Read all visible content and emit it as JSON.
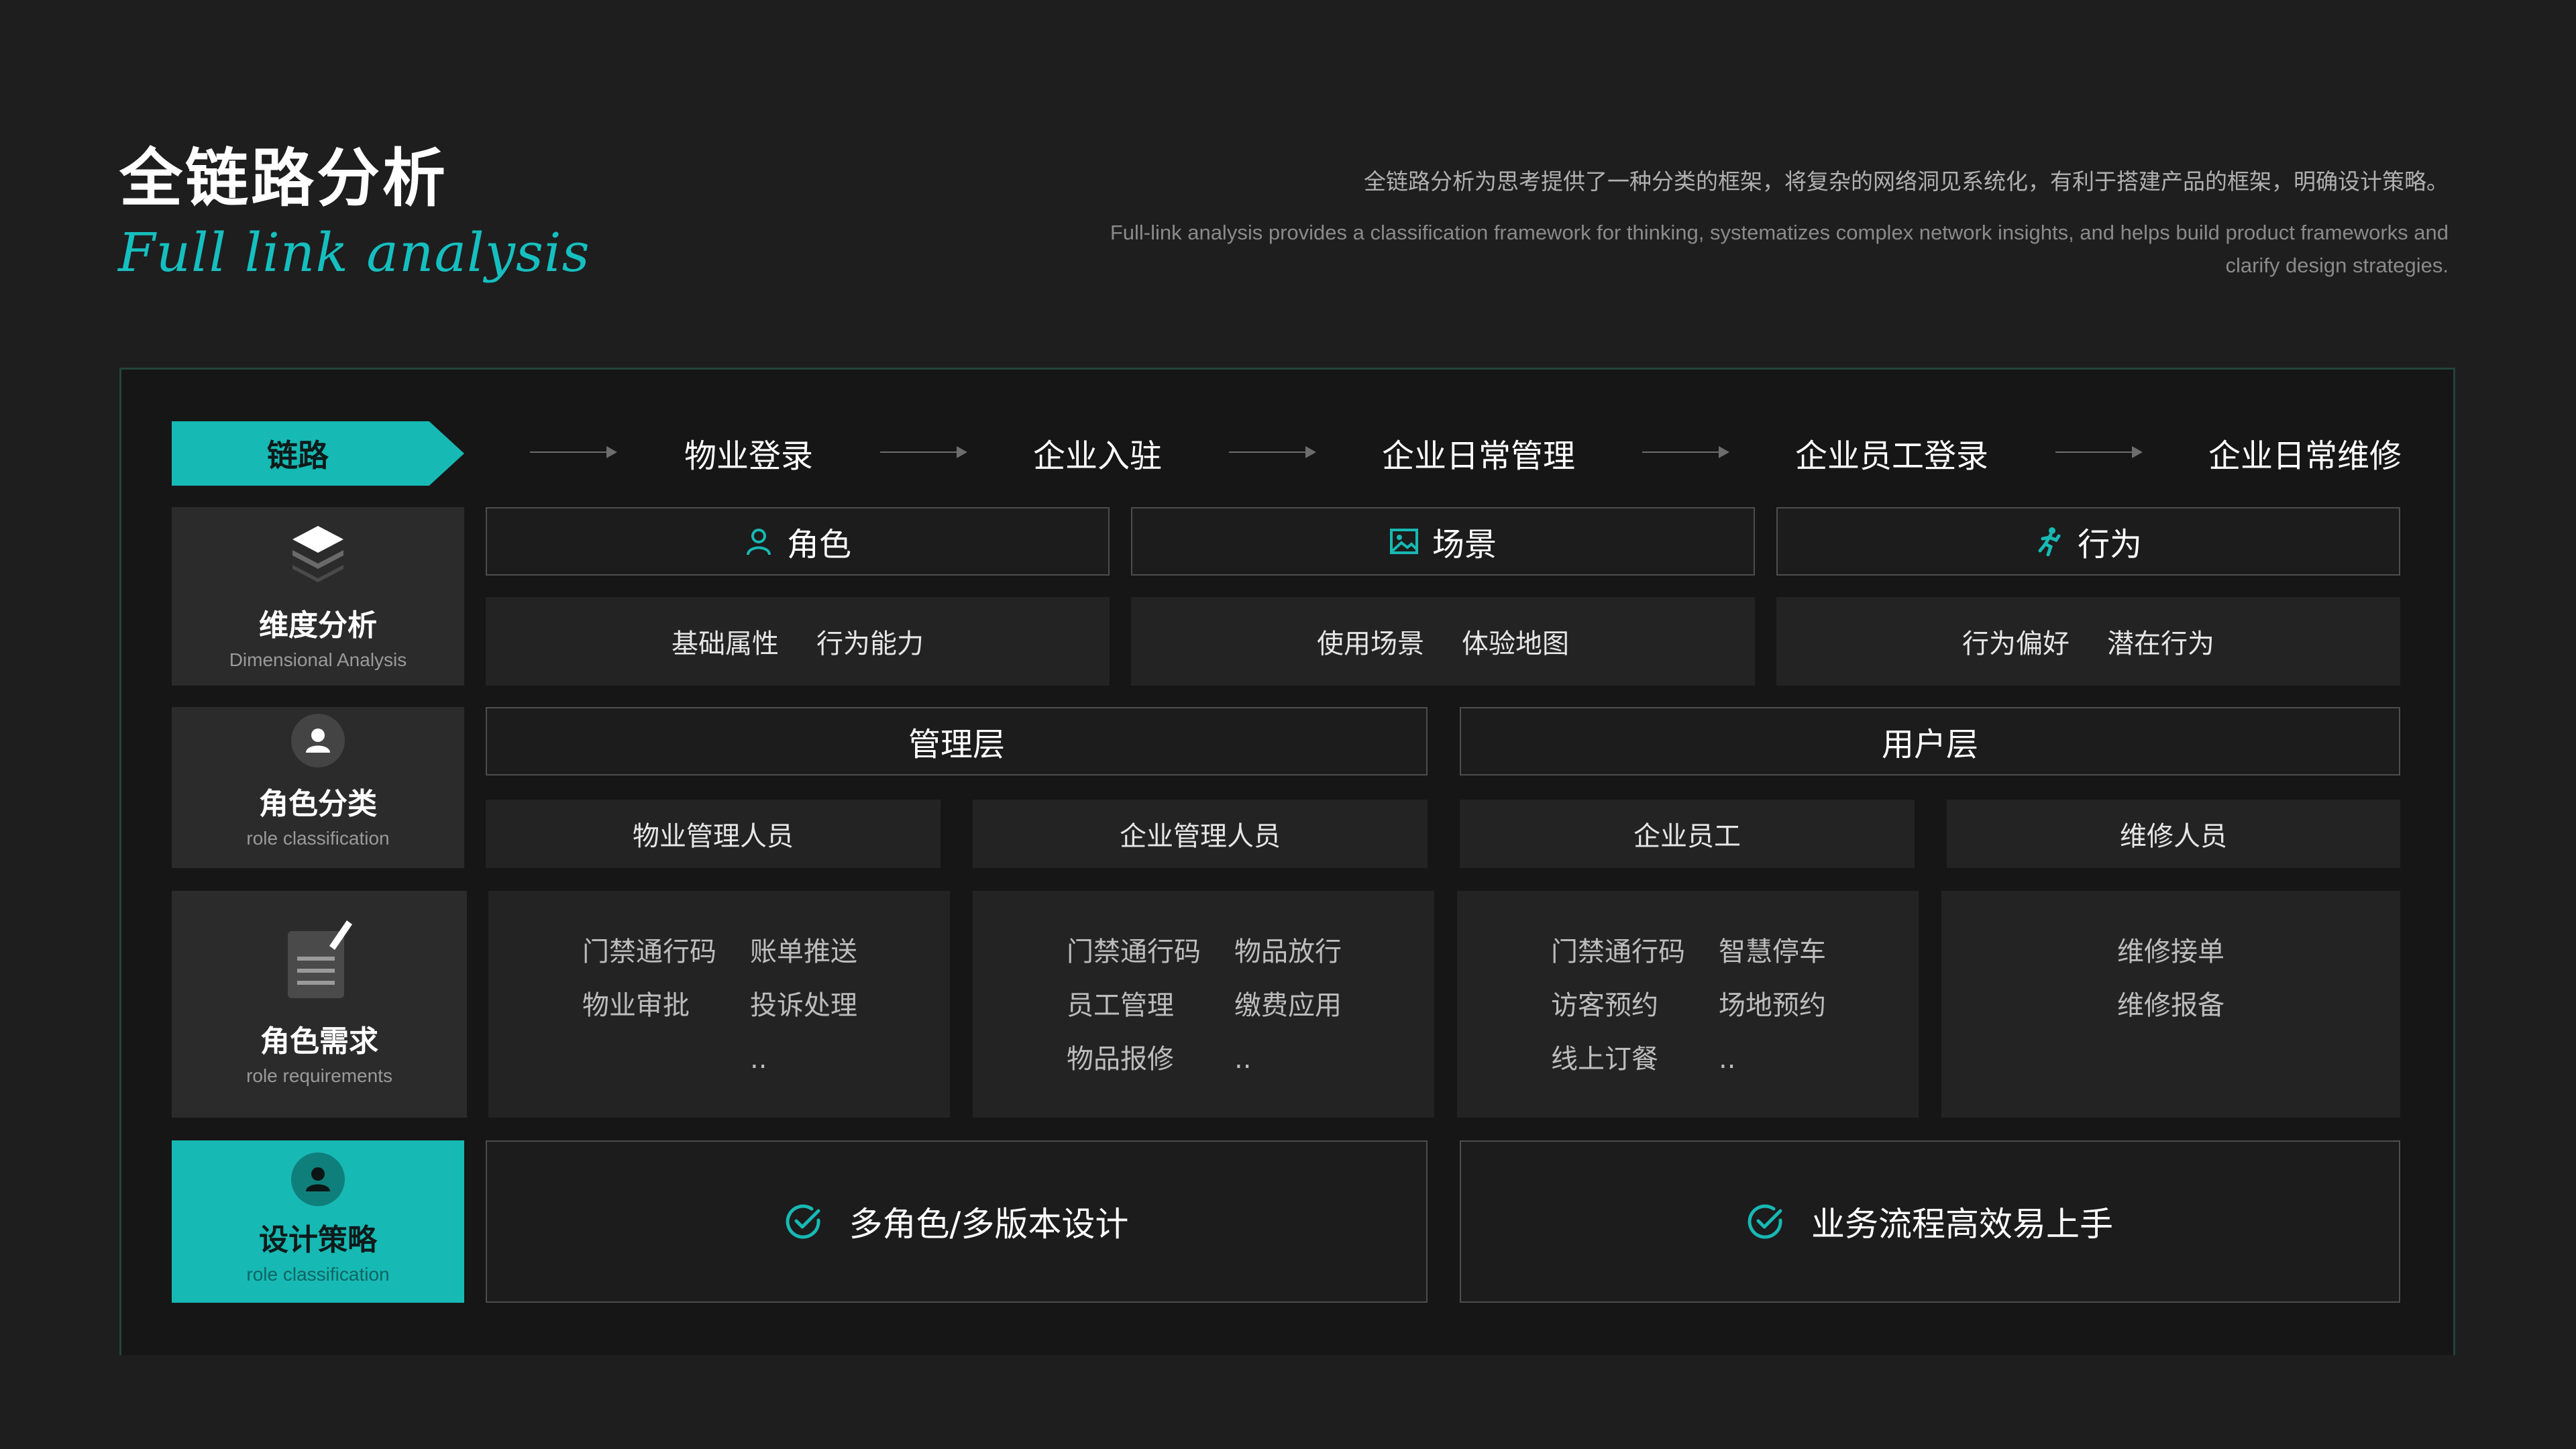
{
  "header": {
    "title": "全链路分析",
    "subtitle": "Full link analysis",
    "description_cn": "全链路分析为思考提供了一种分类的框架，将复杂的网络洞见系统化，有利于搭建产品的框架，明确设计策略。",
    "description_en": "Full-link analysis provides a classification framework for thinking, systematizes complex network insights, and helps build product frameworks and clarify design strategies."
  },
  "colors": {
    "accent": "#17b9b4",
    "background": "#1e1e1f",
    "card": "#2b2b2c"
  },
  "chain": {
    "label": "链路",
    "steps": [
      "物业登录",
      "企业入驻",
      "企业日常管理",
      "企业员工登录",
      "企业日常维修"
    ]
  },
  "dimension": {
    "label_cn": "维度分析",
    "label_en": "Dimensional Analysis",
    "icon": "layers-icon",
    "groups": [
      {
        "title": "角色",
        "icon": "user-outline-icon",
        "items": [
          "基础属性",
          "行为能力"
        ]
      },
      {
        "title": "场景",
        "icon": "image-icon",
        "items": [
          "使用场景",
          "体验地图"
        ]
      },
      {
        "title": "行为",
        "icon": "running-person-icon",
        "items": [
          "行为偏好",
          "潜在行为"
        ]
      }
    ]
  },
  "roles": {
    "label_cn": "角色分类",
    "label_en": "role classification",
    "icon": "person-circle-icon",
    "layers": [
      "管理层",
      "用户层"
    ],
    "items": [
      "物业管理人员",
      "企业管理人员",
      "企业员工",
      "维修人员"
    ]
  },
  "requirements": {
    "label_cn": "角色需求",
    "label_en": "role requirements",
    "icon": "document-edit-icon",
    "columns": [
      [
        "门禁通行码",
        "账单推送",
        "物业审批",
        "投诉处理",
        "",
        ".."
      ],
      [
        "门禁通行码",
        "物品放行",
        "员工管理",
        "缴费应用",
        "物品报修",
        ".."
      ],
      [
        "门禁通行码",
        "智慧停车",
        "访客预约",
        "场地预约",
        "线上订餐",
        ".."
      ],
      [
        "维修接单",
        "",
        "维修报备",
        ""
      ]
    ]
  },
  "strategy": {
    "label_cn": "设计策略",
    "label_en": "role classification",
    "icon": "person-circle-icon",
    "items": [
      "多角色/多版本设计",
      "业务流程高效易上手"
    ]
  }
}
